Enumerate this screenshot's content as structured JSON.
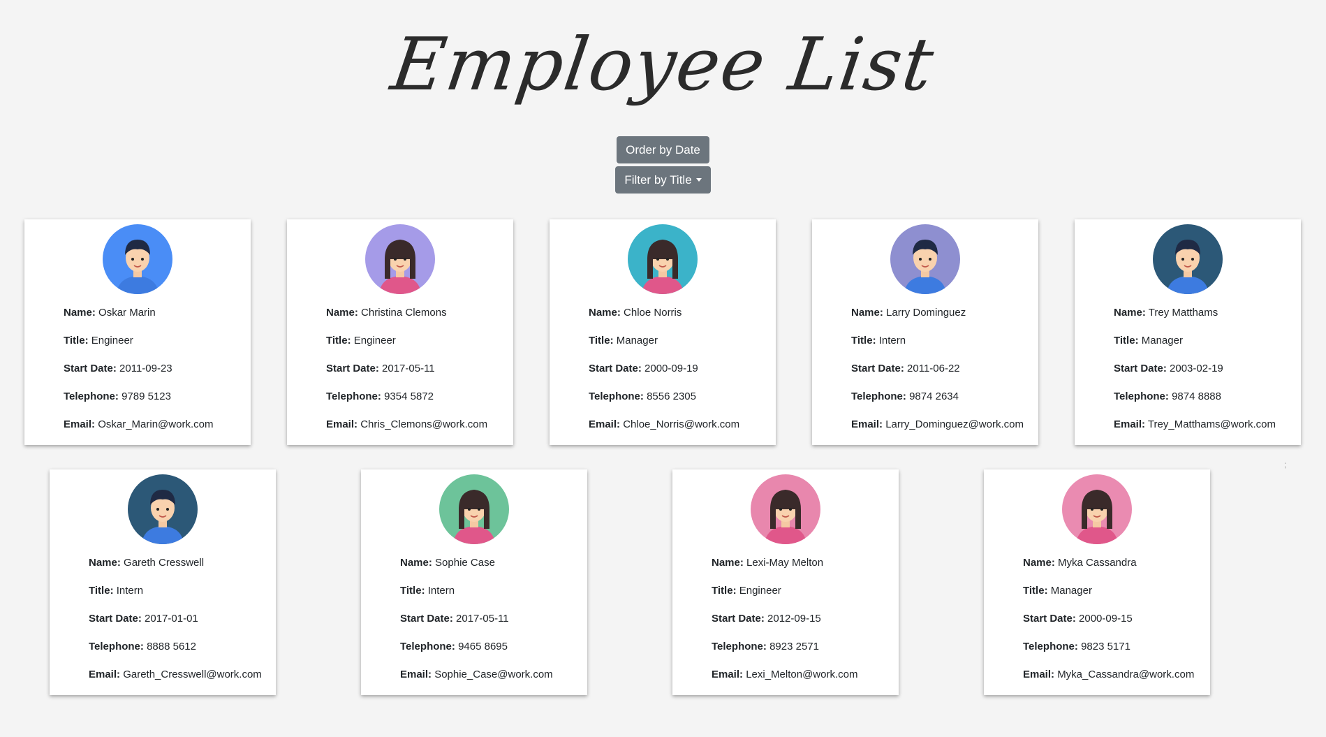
{
  "page": {
    "title": "Employee List",
    "background": "#f4f4f4"
  },
  "controls": {
    "order_label": "Order by Date",
    "filter_label": "Filter by Title",
    "button_color": "#6c757d"
  },
  "labels": {
    "name": "Name:",
    "title": "Title:",
    "start_date": "Start Date:",
    "telephone": "Telephone:",
    "email": "Email:"
  },
  "employees": [
    {
      "name": "Oskar Marin",
      "title": "Engineer",
      "start_date": "2011-09-23",
      "telephone": "9789 5123",
      "email": "Oskar_Marin@work.com",
      "avatar_icon": "male-avatar-icon",
      "avatar_bg": "#4a8df6"
    },
    {
      "name": "Christina Clemons",
      "title": "Engineer",
      "start_date": "2017-05-11",
      "telephone": "9354 5872",
      "email": "Chris_Clemons@work.com",
      "avatar_icon": "female-avatar-icon",
      "avatar_bg": "#a59be8"
    },
    {
      "name": "Chloe Norris",
      "title": "Manager",
      "start_date": "2000-09-19",
      "telephone": "8556 2305",
      "email": "Chloe_Norris@work.com",
      "avatar_icon": "elderly-female-avatar-icon",
      "avatar_bg": "#3bb3c9"
    },
    {
      "name": "Larry Dominguez",
      "title": "Intern",
      "start_date": "2011-06-22",
      "telephone": "9874 2634",
      "email": "Larry_Dominguez@work.com",
      "avatar_icon": "male-avatar-icon",
      "avatar_bg": "#8e8fd0"
    },
    {
      "name": "Trey Matthams",
      "title": "Manager",
      "start_date": "2003-02-19",
      "telephone": "9874 8888",
      "email": "Trey_Matthams@work.com",
      "avatar_icon": "male-avatar-icon",
      "avatar_bg": "#2c5877"
    },
    {
      "name": "Gareth Cresswell",
      "title": "Intern",
      "start_date": "2017-01-01",
      "telephone": "8888 5612",
      "email": "Gareth_Cresswell@work.com",
      "avatar_icon": "male-avatar-icon",
      "avatar_bg": "#2c5877"
    },
    {
      "name": "Sophie Case",
      "title": "Intern",
      "start_date": "2017-05-11",
      "telephone": "9465 8695",
      "email": "Sophie_Case@work.com",
      "avatar_icon": "female-avatar-icon",
      "avatar_bg": "#6dc39a"
    },
    {
      "name": "Lexi-May Melton",
      "title": "Engineer",
      "start_date": "2012-09-15",
      "telephone": "8923 2571",
      "email": "Lexi_Melton@work.com",
      "avatar_icon": "female-avatar-icon",
      "avatar_bg": "#e887ad"
    },
    {
      "name": "Myka Cassandra",
      "title": "Manager",
      "start_date": "2000-09-15",
      "telephone": "9823 5171",
      "email": "Myka_Cassandra@work.com",
      "avatar_icon": "female-avatar-icon",
      "avatar_bg": "#ea8bb1"
    }
  ],
  "stray_mark": ";"
}
